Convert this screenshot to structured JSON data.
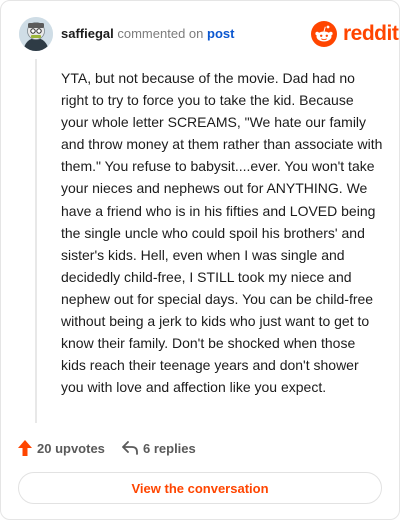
{
  "header": {
    "username": "saffiegal",
    "action_text": "commented on",
    "post_link": "post",
    "brand": "reddit",
    "avatar_icon": "avatar-icon",
    "brand_icon": "reddit-logo-icon",
    "brand_color": "#ff4500"
  },
  "comment": {
    "text": "YTA, but not because of the movie. Dad had no right to try to force you to take the kid. Because your whole letter SCREAMS, \"We hate our family and throw money at them rather than associate with them.\" You refuse to babysit....ever. You won't take your nieces and nephews out for ANYTHING. We have a friend who is in his fifties and LOVED being the single uncle who could spoil his brothers' and sister's kids. Hell, even when I was single and decidedly child-free, I STILL took my niece and nephew out for special days. You can be child-free without being a jerk to kids who just want to get to know their family. Don't be shocked when those kids reach their teenage years and don't shower you with love and affection like you expect."
  },
  "actions": {
    "upvotes": "20 upvotes",
    "replies": "6 replies",
    "upvote_icon": "upvote-arrow-icon",
    "reply_icon": "reply-arrow-icon"
  },
  "footer": {
    "button_label": "View the conversation"
  }
}
